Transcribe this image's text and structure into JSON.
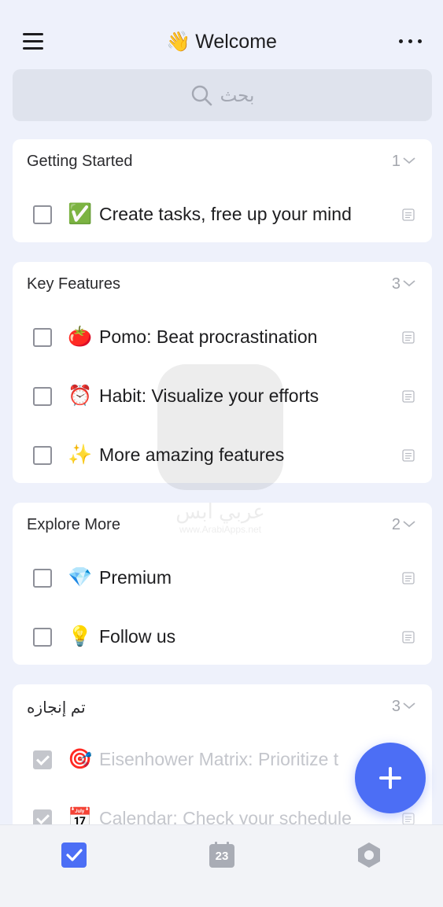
{
  "header": {
    "title_emoji": "👋",
    "title": "Welcome"
  },
  "search": {
    "placeholder": "بحث"
  },
  "lists": [
    {
      "name": "Getting Started",
      "count": "1",
      "tasks": [
        {
          "emoji": "✅",
          "text": "Create tasks, free up your mind",
          "done": false
        }
      ]
    },
    {
      "name": "Key Features",
      "count": "3",
      "tasks": [
        {
          "emoji": "🍅",
          "text": "Pomo: Beat procrastination",
          "done": false
        },
        {
          "emoji": "⏰",
          "text": "Habit: Visualize your efforts",
          "done": false
        },
        {
          "emoji": "✨",
          "text": "More amazing features",
          "done": false
        }
      ]
    },
    {
      "name": "Explore More",
      "count": "2",
      "tasks": [
        {
          "emoji": "💎",
          "text": "Premium",
          "done": false
        },
        {
          "emoji": "💡",
          "text": "Follow us",
          "done": false
        }
      ]
    },
    {
      "name": "تم إنجازه",
      "count": "3",
      "tasks": [
        {
          "emoji": "🎯",
          "text": "Eisenhower Matrix: Prioritize t",
          "done": true
        },
        {
          "emoji": "📅",
          "text": "Calendar: Check your schedule",
          "done": true
        }
      ]
    }
  ],
  "bottom_nav": {
    "calendar_day": "23",
    "tabs": [
      "checkbox-icon",
      "calendar-icon",
      "settings-icon"
    ]
  },
  "watermark": {
    "text": "عربي ابس",
    "url": "www.ArabiApps.net"
  },
  "colors": {
    "accent": "#4c6ef5",
    "background": "#eef1fb",
    "card": "#ffffff",
    "muted": "#a3a6ad"
  }
}
